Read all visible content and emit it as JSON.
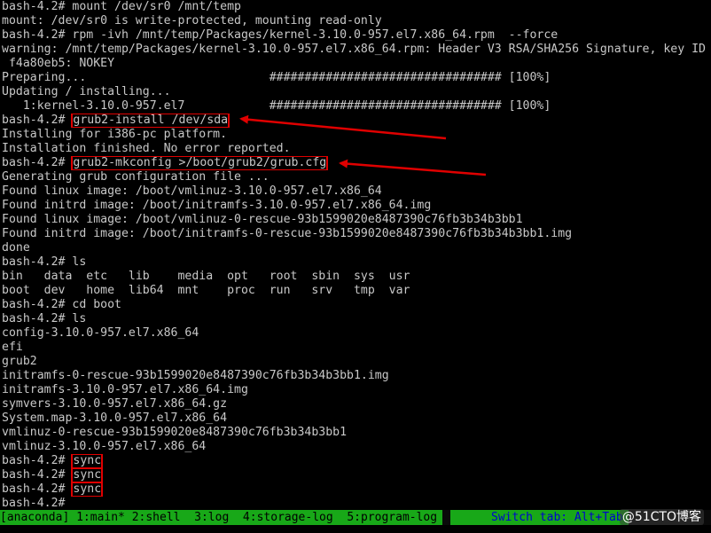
{
  "terminal": {
    "lines": [
      "bash-4.2# mount /dev/sr0 /mnt/temp",
      "mount: /dev/sr0 is write-protected, mounting read-only",
      "bash-4.2# rpm -ivh /mnt/temp/Packages/kernel-3.10.0-957.el7.x86_64.rpm  --force",
      "warning: /mnt/temp/Packages/kernel-3.10.0-957.el7.x86_64.rpm: Header V3 RSA/SHA256 Signature, key ID",
      " f4a80eb5: NOKEY",
      "Preparing...                          ################################# [100%]",
      "Updating / installing...",
      "   1:kernel-3.10.0-957.el7            ################################# [100%]",
      "bash-4.2# grub2-install /dev/sda",
      "Installing for i386-pc platform.",
      "Installation finished. No error reported.",
      "bash-4.2# grub2-mkconfig >/boot/grub2/grub.cfg",
      "Generating grub configuration file ...",
      "Found linux image: /boot/vmlinuz-3.10.0-957.el7.x86_64",
      "Found initrd image: /boot/initramfs-3.10.0-957.el7.x86_64.img",
      "Found linux image: /boot/vmlinuz-0-rescue-93b1599020e8487390c76fb3b34b3bb1",
      "Found initrd image: /boot/initramfs-0-rescue-93b1599020e8487390c76fb3b34b3bb1.img",
      "done",
      "bash-4.2# ls",
      "bin   data  etc   lib    media  opt   root  sbin  sys  usr",
      "boot  dev   home  lib64  mnt    proc  run   srv   tmp  var",
      "bash-4.2# cd boot",
      "bash-4.2# ls",
      "config-3.10.0-957.el7.x86_64",
      "efi",
      "grub2",
      "initramfs-0-rescue-93b1599020e8487390c76fb3b34b3bb1.img",
      "initramfs-3.10.0-957.el7.x86_64.img",
      "symvers-3.10.0-957.el7.x86_64.gz",
      "System.map-3.10.0-957.el7.x86_64",
      "vmlinuz-0-rescue-93b1599020e8487390c76fb3b34b3bb1",
      "vmlinuz-3.10.0-957.el7.x86_64",
      "bash-4.2# sync",
      "bash-4.2# sync",
      "bash-4.2# sync",
      "bash-4.2# "
    ],
    "highlighted_commands": {
      "8": {
        "prompt": "bash-4.2# ",
        "cmd": "grub2-install /dev/sda"
      },
      "11": {
        "prompt": "bash-4.2# ",
        "cmd": "grub2-mkconfig >/boot/grub2/grub.cfg"
      },
      "32": {
        "prompt": "bash-4.2# ",
        "cmd": "sync"
      },
      "33": {
        "prompt": "bash-4.2# ",
        "cmd": "sync"
      },
      "34": {
        "prompt": "bash-4.2# ",
        "cmd": "sync"
      }
    }
  },
  "statusbar": {
    "left": "[anaconda] 1:main* 2:shell  3:log  4:storage-log  5:program-log",
    "right": "Switch tab: Alt+Tab"
  },
  "watermark": "@51CTO博客",
  "colors": {
    "text": "#c8c8c8",
    "status_green": "#18a818",
    "highlight_red": "#e00000"
  }
}
